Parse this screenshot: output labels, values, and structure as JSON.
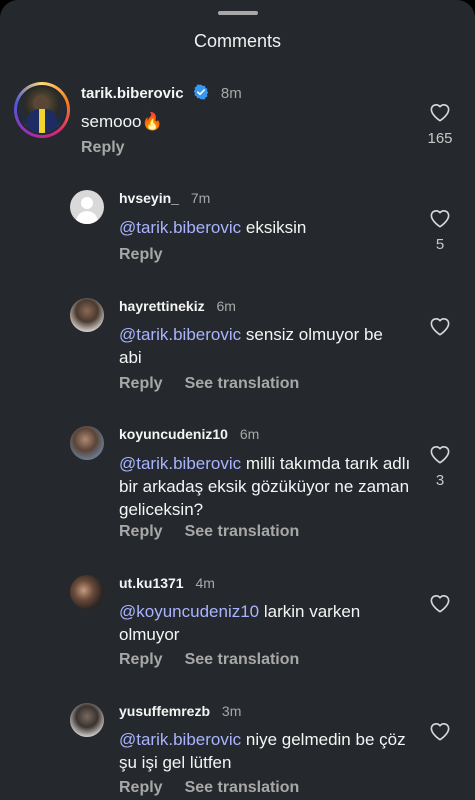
{
  "header": {
    "title": "Comments"
  },
  "comments": [
    {
      "username": "tarik.biberovic",
      "verified": true,
      "time": "8m",
      "mention": "",
      "text": "semooo🔥",
      "reply": "Reply",
      "see_translation": "",
      "likes": "165"
    },
    {
      "username": "hvseyin_",
      "time": "7m",
      "mention": "@tarik.biberovic",
      "text": " eksiksin",
      "reply": "Reply",
      "see_translation": "",
      "likes": "5"
    },
    {
      "username": "hayrettinekiz",
      "time": "6m",
      "mention": "@tarik.biberovic",
      "text": " sensiz olmuyor be abi",
      "reply": "Reply",
      "see_translation": "See translation",
      "likes": ""
    },
    {
      "username": "koyuncudeniz10",
      "time": "6m",
      "mention": "@tarik.biberovic",
      "text": " milli takımda tarık adlı bir arkadaş eksik gözüküyor ne zaman geliceksin?",
      "reply": "Reply",
      "see_translation": "See translation",
      "likes": "3"
    },
    {
      "username": "ut.ku1371",
      "time": "4m",
      "mention": "@koyuncudeniz10",
      "text": "  larkin varken olmuyor",
      "reply": "Reply",
      "see_translation": "See translation",
      "likes": ""
    },
    {
      "username": "yusuffemrezb",
      "time": "3m",
      "mention": "@tarik.biberovic",
      "text": " niye gelmedin be çöz  şu işi gel lütfen",
      "reply": "Reply",
      "see_translation": "See translation",
      "likes": ""
    }
  ],
  "colors": {
    "background": "#25282c",
    "mention": "#a9b4ff",
    "verified": "#3897f0",
    "ring": "#d62976"
  },
  "icons": {
    "like": "heart-outline-icon",
    "verified": "verified-badge-icon"
  }
}
